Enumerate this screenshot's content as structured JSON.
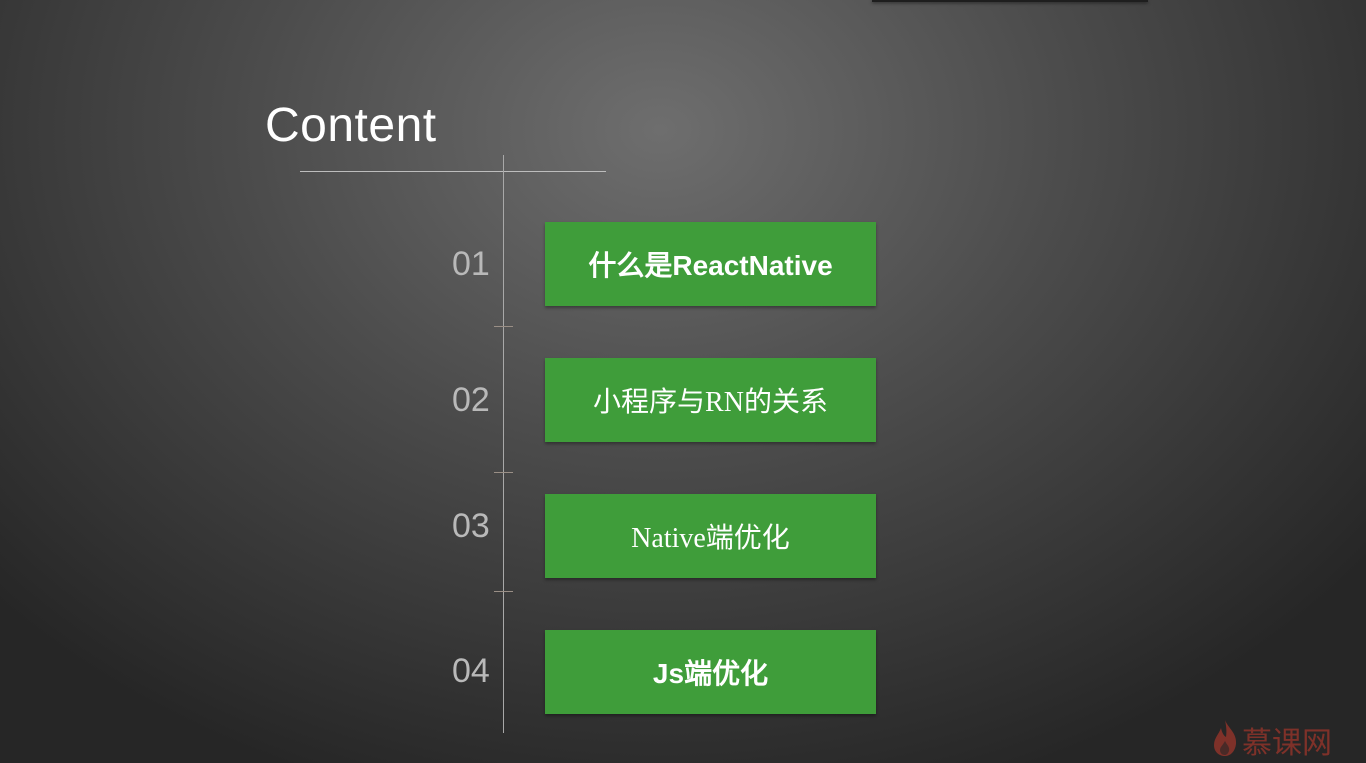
{
  "slide": {
    "title": "Content",
    "items": [
      {
        "number": "01",
        "label": "什么是ReactNative"
      },
      {
        "number": "02",
        "label": "小程序与RN的关系"
      },
      {
        "number": "03",
        "label": "Native端优化"
      },
      {
        "number": "04",
        "label": "Js端优化"
      }
    ],
    "colors": {
      "item_background": "#3f9d3a",
      "number_text": "#b9b9b9",
      "watermark": "#c63a2c"
    }
  },
  "watermark": {
    "text": "慕课网",
    "icon": "flame-icon"
  }
}
